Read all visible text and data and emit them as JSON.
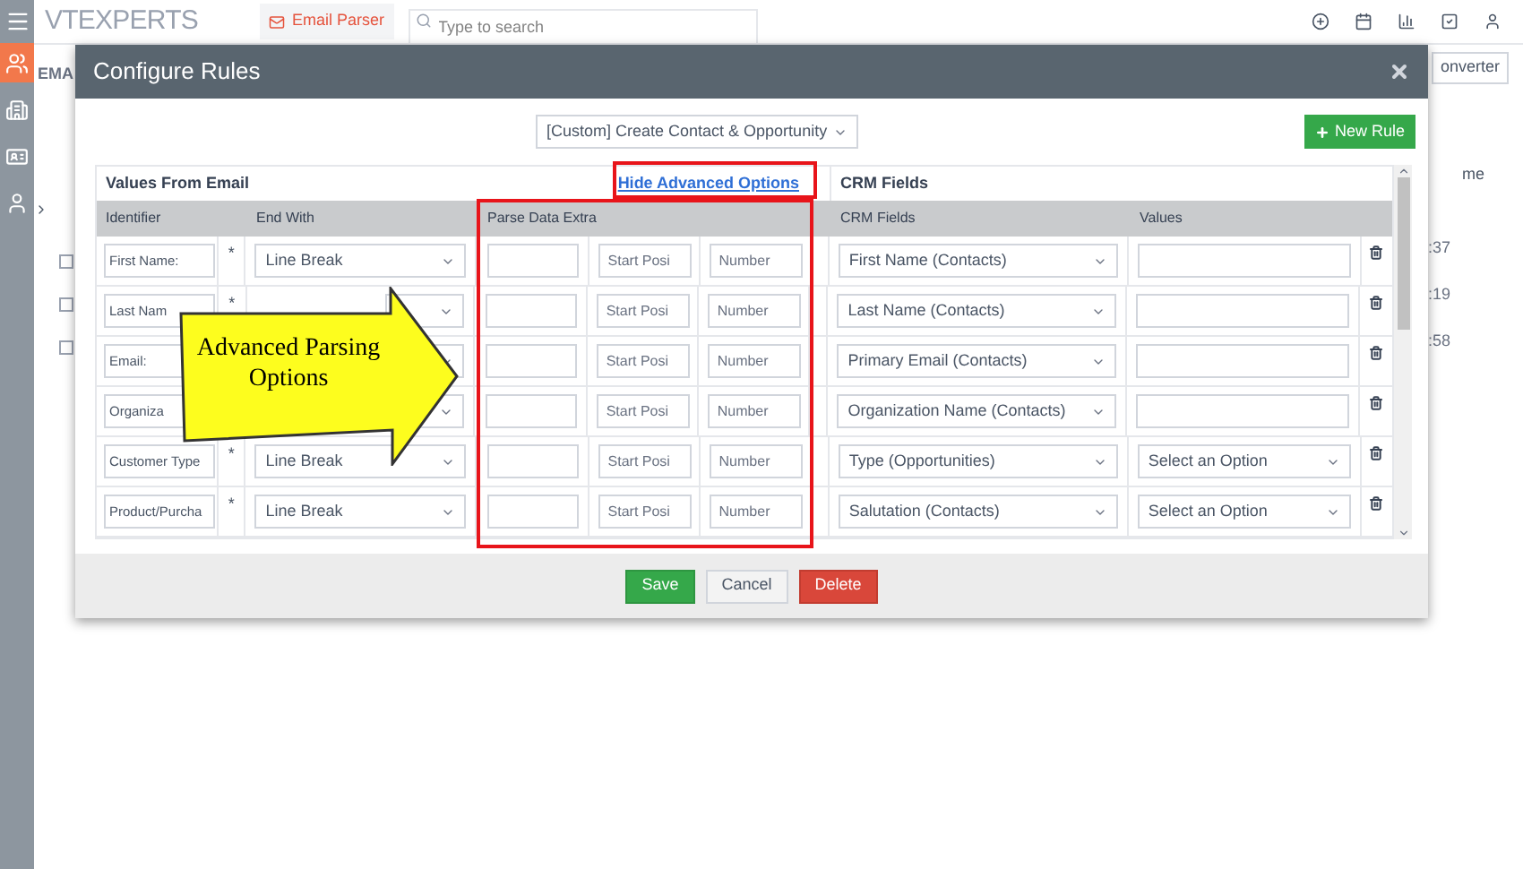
{
  "app": {
    "logo": "VTEXPERTS",
    "module_tab": "Email Parser",
    "search": {
      "placeholder": "Type to search"
    }
  },
  "background": {
    "page_title": "EMA",
    "converter_button": "onverter",
    "column_heading": "me",
    "rows": [
      {
        "checked": false,
        "time": ":37"
      },
      {
        "checked": false,
        "time": ":19"
      },
      {
        "checked": false,
        "time": ":58"
      }
    ]
  },
  "dialog": {
    "title": "Configure Rules",
    "rule_select": "[Custom] Create Contact & Opportunity",
    "new_rule_button": "New Rule",
    "left_section": "Values From Email",
    "advanced_link": "Hide Advanced Options",
    "right_section": "CRM Fields",
    "columns": [
      "Identifier",
      "End With",
      "Parse Data Extra",
      "CRM Fields",
      "Values"
    ],
    "rows": [
      {
        "identifier": "First Name:",
        "required_mark": "*",
        "end_with": "Line Break",
        "start_placeholder": "Start Posi",
        "number_placeholder": "Number",
        "crm_field": "First Name (Contacts)",
        "value": {
          "kind": "text"
        }
      },
      {
        "identifier": "Last Nam",
        "required_mark": "*",
        "start_placeholder": "Start Posi",
        "number_placeholder": "Number",
        "crm_field": "Last Name (Contacts)",
        "value": {
          "kind": "text"
        }
      },
      {
        "identifier": "Email:",
        "start_placeholder": "Start Posi",
        "number_placeholder": "Number",
        "crm_field": "Primary Email (Contacts)",
        "value": {
          "kind": "text"
        }
      },
      {
        "identifier": "Organiza",
        "start_placeholder": "Start Posi",
        "number_placeholder": "Number",
        "crm_field": "Organization Name (Contacts)",
        "value": {
          "kind": "text"
        }
      },
      {
        "identifier": "Customer Type",
        "required_mark": "*",
        "end_with": "Line Break",
        "start_placeholder": "Start Posi",
        "number_placeholder": "Number",
        "crm_field": "Type (Opportunities)",
        "value": {
          "kind": "select",
          "text": "Select an Option"
        }
      },
      {
        "identifier": "Product/Purcha",
        "required_mark": "*",
        "end_with": "Line Break",
        "start_placeholder": "Start Posi",
        "number_placeholder": "Number",
        "crm_field": "Salutation (Contacts)",
        "value": {
          "kind": "select",
          "text": "Select an Option"
        }
      }
    ],
    "buttons": [
      {
        "kind": "primary",
        "label": "Save"
      },
      {
        "kind": "default",
        "label": "Cancel"
      },
      {
        "kind": "danger",
        "label": "Delete"
      }
    ]
  },
  "callout": {
    "text": "Advanced Parsing Options"
  }
}
